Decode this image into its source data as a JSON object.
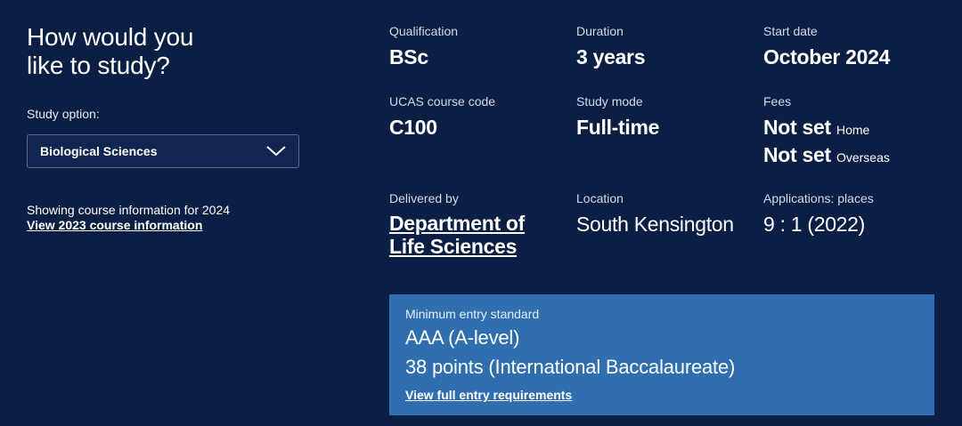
{
  "left": {
    "heading_line1": "How would you",
    "heading_line2": "like to study?",
    "study_option_label": "Study option:",
    "selected_option": "Biological Sciences",
    "showing_text": "Showing course information for 2024",
    "view_2023_link": "View 2023 course information"
  },
  "info": {
    "qualification": {
      "label": "Qualification",
      "value": "BSc"
    },
    "duration": {
      "label": "Duration",
      "value": "3 years"
    },
    "start_date": {
      "label": "Start date",
      "value": "October 2024"
    },
    "ucas": {
      "label": "UCAS course code",
      "value": "C100"
    },
    "study_mode": {
      "label": "Study mode",
      "value": "Full-time"
    },
    "fees": {
      "label": "Fees",
      "home_value": "Not set",
      "home_suffix": "Home",
      "overseas_value": "Not set",
      "overseas_suffix": "Overseas"
    },
    "delivered_by": {
      "label": "Delivered by",
      "line1": "Department of",
      "line2": "Life Sciences"
    },
    "location": {
      "label": "Location",
      "value": "South Kensington"
    },
    "applications": {
      "label": "Applications: places",
      "value": "9 : 1 (2022)"
    }
  },
  "entry": {
    "label": "Minimum entry standard",
    "line1": "AAA (A-level)",
    "line2": "38 points (International Baccalaureate)",
    "link": "View full entry requirements"
  },
  "colors": {
    "background": "#0b1f45",
    "entry_box": "#2f6fb0"
  },
  "icons": {
    "dropdown": "chevron-down-icon"
  }
}
